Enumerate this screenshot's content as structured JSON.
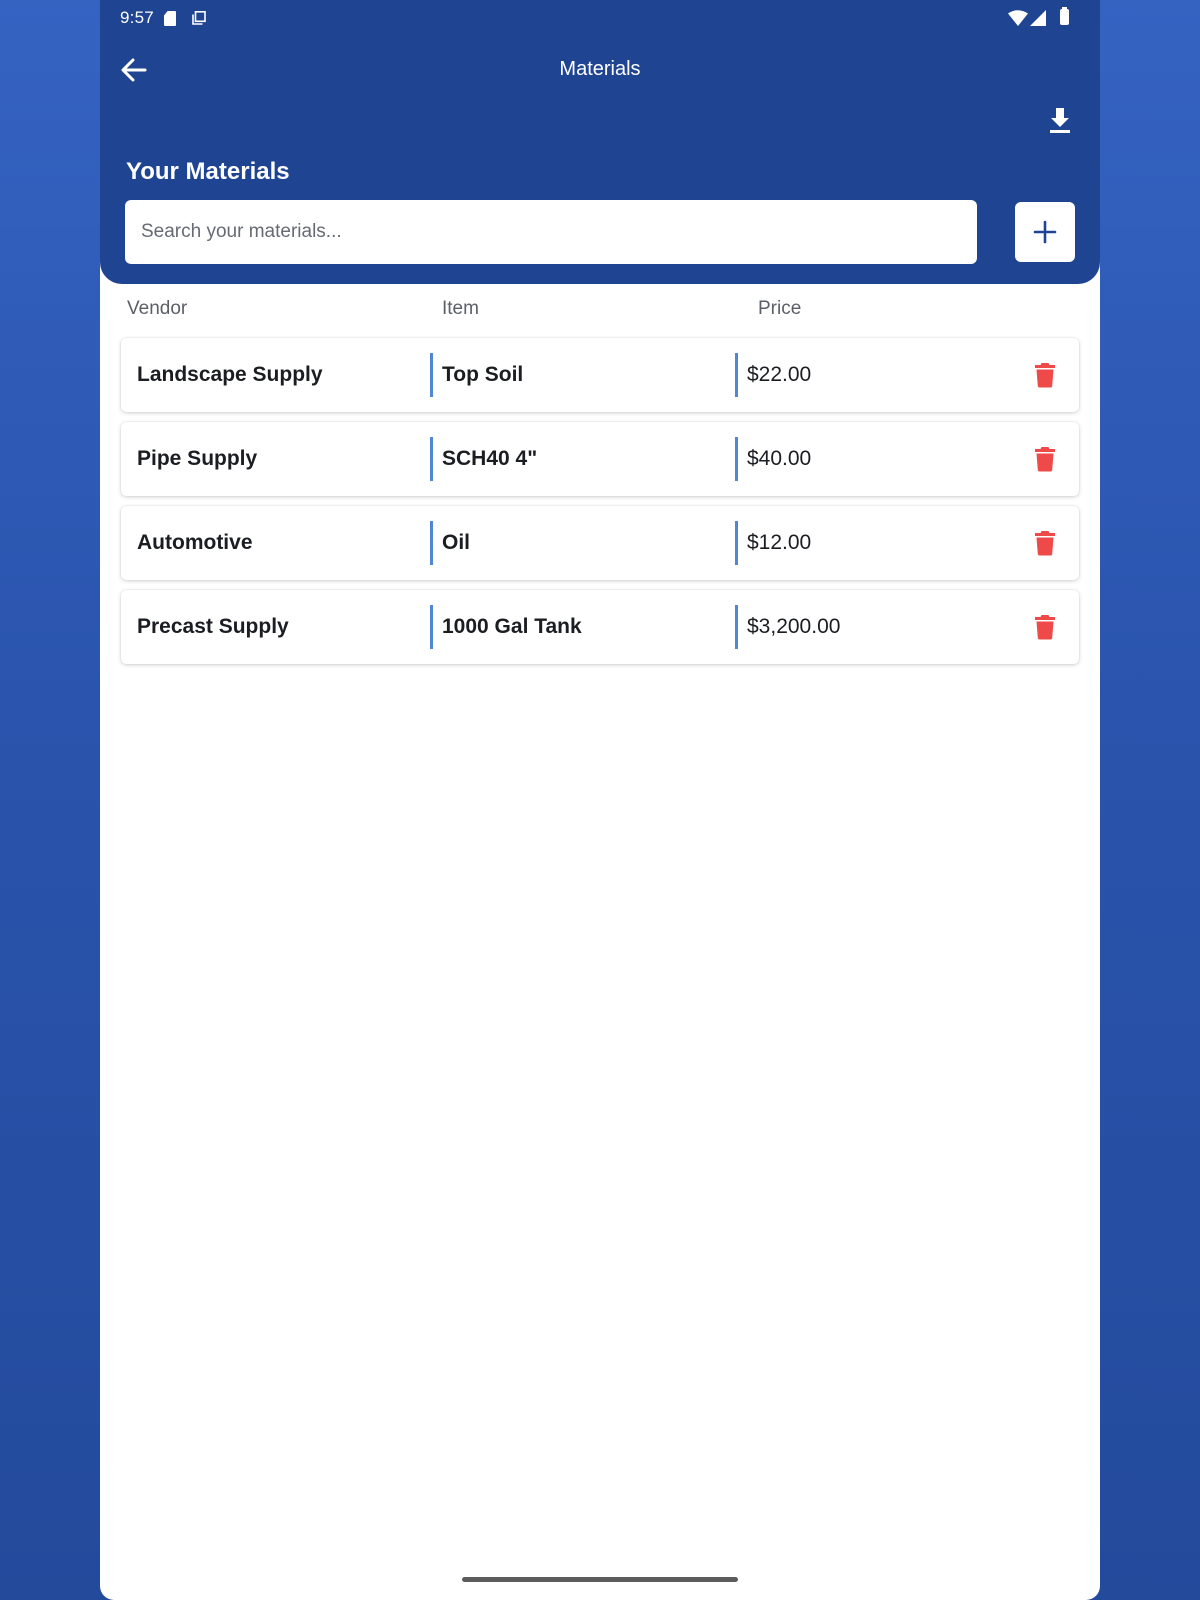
{
  "status_bar": {
    "time": "9:57"
  },
  "header": {
    "title": "Materials",
    "section_title": "Your Materials"
  },
  "search": {
    "placeholder": "Search your materials..."
  },
  "columns": {
    "vendor": "Vendor",
    "item": "Item",
    "price": "Price"
  },
  "materials": [
    {
      "vendor": "Landscape Supply",
      "item": "Top Soil",
      "price": "$22.00"
    },
    {
      "vendor": "Pipe Supply",
      "item": "SCH40 4\"",
      "price": "$40.00"
    },
    {
      "vendor": "Automotive",
      "item": "Oil",
      "price": "$12.00"
    },
    {
      "vendor": "Precast Supply",
      "item": "1000 Gal Tank",
      "price": "$3,200.00"
    }
  ],
  "colors": {
    "header_bg": "#1f4492",
    "divider": "#4f86d6",
    "delete": "#ef4a4a",
    "add_icon": "#1f4492"
  },
  "icons": {
    "back": "arrow-left-icon",
    "download": "download-icon",
    "add": "plus-icon",
    "delete": "trash-icon"
  }
}
